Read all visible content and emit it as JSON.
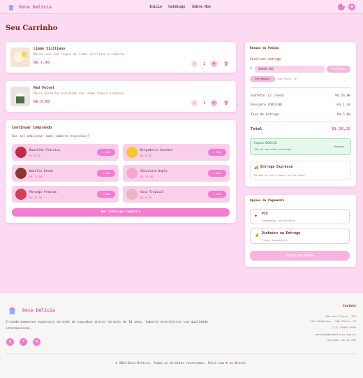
{
  "header": {
    "brand": "Doce Delícia",
    "nav": [
      "Início",
      "Catálogo",
      "Sobre Nós"
    ],
    "cart_count": "2",
    "icons": [
      "cart-icon",
      "user-icon"
    ]
  },
  "page_title": "Seu Carrinho",
  "cart_items": [
    {
      "name": "Limão Siciliano",
      "description": "Massa leve com raspas de limão siciliano e cobertu...",
      "price": "R$ 7,90",
      "quantity": "1"
    },
    {
      "name": "Red Velvet",
      "description": "Massa vermelha aveludada com cream cheese artesana...",
      "price": "R$ 8,90",
      "quantity": "1"
    }
  ],
  "continue": {
    "title": "Continuar Comprando",
    "subtitle": "Que tal adicionar mais sabores especiais?",
    "add_label": "+ Add",
    "items": [
      {
        "name": "Baunilha Clássica",
        "price": "R$ 6,90"
      },
      {
        "name": "Brigadeiro Gourmet",
        "price": "R$ 8,50"
      },
      {
        "name": "Nutella Dream",
        "price": "R$ 11,90"
      },
      {
        "name": "Chocolate Duplo",
        "price": "R$ 10,90"
      },
      {
        "name": "Morango Premium",
        "price": "R$ 14,90"
      },
      {
        "name": "Coco Tropical",
        "price": "R$ 9,20"
      }
    ],
    "catalog_button": "Ver Catálogo Completo"
  },
  "summary": {
    "title": "Resumo do Pedido",
    "delivery_label": "Verificar entrega",
    "cep_value": "00000-000",
    "verify_button": "Verificar",
    "delivery_chip": "Entregamos",
    "delivery_city": "São Paulo, SP",
    "rows": [
      {
        "label": "Subtotal (2 itens)",
        "value": "R$ 16,80"
      },
      {
        "label": "Desconto (DOCE10)",
        "value": "-R$ 1,68"
      },
      {
        "label": "Taxa de entrega",
        "value": "R$ 5,00"
      }
    ],
    "total_label": "Total",
    "total_value": "R$ 20,12",
    "coupon_title": "Cupom DOCE10",
    "coupon_sub": "10% de desconto aplicado",
    "coupon_remove": "Remover",
    "express_title": "Entrega Expressa",
    "express_sub": "Receba em até 2 horas na sua casa!"
  },
  "payment": {
    "title": "Opções de Pagamento",
    "options": [
      {
        "title": "PIX",
        "sub": "Pagamento instantâneo"
      },
      {
        "title": "Dinheiro na Entrega",
        "sub": "Troco disponível"
      }
    ],
    "finish_button": "Finalizar Pedido"
  },
  "footer": {
    "brand": "Doce Delícia",
    "about": "Criando momentos especiais através de cupcakes únicos há mais de 10 anos. Sabores brasileiros com qualidade internacional.",
    "contact_title": "Contato",
    "address1": "Rua das Flores, 123",
    "address2": "Vila Madalena - São Paulo, SP",
    "phone": "(11) 99999-9999",
    "email": "contato@docedelicia.com.br",
    "hours": "Seg-Dom: 8h às 20h",
    "copyright_pre": "© 2024 Doce Delícia. Todos os direitos reservados. Feito com",
    "copyright_post": "no Brasil."
  },
  "colors": {
    "accent": "#f27cd0",
    "brand": "#e255b5",
    "background": "#fcdaf2",
    "title": "#7a2510"
  }
}
